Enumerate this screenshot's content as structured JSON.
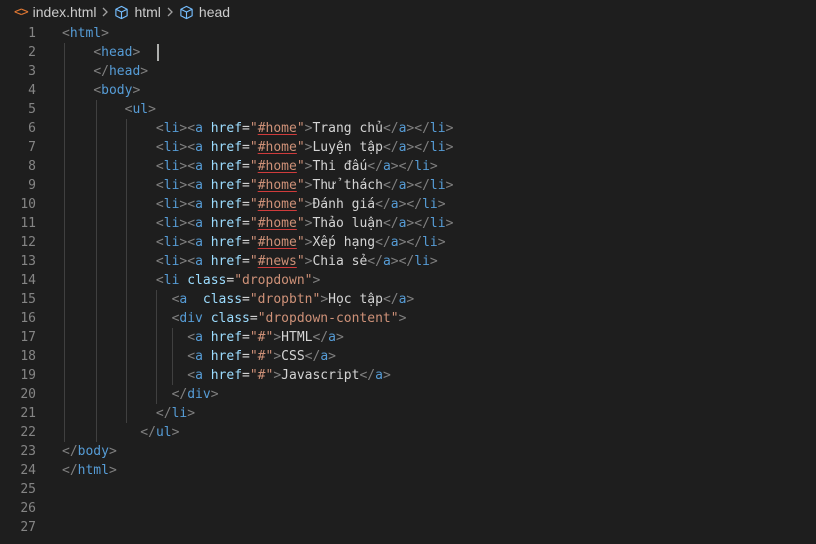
{
  "breadcrumb": {
    "file": "index.html",
    "crumbs": [
      "html",
      "head"
    ]
  },
  "colors": {
    "background": "#1e1e1e",
    "tag": "#569cd6",
    "bracket": "#808080",
    "attribute": "#9cdcfe",
    "string": "#ce9178",
    "text": "#d4d4d4",
    "line_number": "#858585",
    "file_icon": "#e37933"
  },
  "icons": {
    "file": "html-file-icon",
    "symbol": "cube-symbol-icon",
    "separator": "chevron-right-icon"
  },
  "cursor_line": 2,
  "lines": [
    [
      [
        "b",
        "<"
      ],
      [
        "t",
        "html"
      ],
      [
        "b",
        ">"
      ]
    ],
    [
      [
        "b",
        "<"
      ],
      [
        "t",
        "head"
      ],
      [
        "b",
        ">"
      ]
    ],
    [
      [
        "b",
        "</"
      ],
      [
        "t",
        "head"
      ],
      [
        "b",
        ">"
      ]
    ],
    [
      [
        "b",
        "<"
      ],
      [
        "t",
        "body"
      ],
      [
        "b",
        ">"
      ]
    ],
    [
      [
        "b",
        "<"
      ],
      [
        "t",
        "ul"
      ],
      [
        "b",
        ">"
      ]
    ],
    [
      [
        "b",
        "<"
      ],
      [
        "t",
        "li"
      ],
      [
        "b",
        "><"
      ],
      [
        "t",
        "a"
      ],
      [
        "x",
        " "
      ],
      [
        "a",
        "href"
      ],
      [
        "x",
        "="
      ],
      [
        "s",
        "\""
      ],
      [
        "ss",
        "#home"
      ],
      [
        "s",
        "\""
      ],
      [
        "b",
        ">"
      ],
      [
        "x",
        "Trang chủ"
      ],
      [
        "b",
        "</"
      ],
      [
        "t",
        "a"
      ],
      [
        "b",
        "></"
      ],
      [
        "t",
        "li"
      ],
      [
        "b",
        ">"
      ]
    ],
    [
      [
        "b",
        "<"
      ],
      [
        "t",
        "li"
      ],
      [
        "b",
        "><"
      ],
      [
        "t",
        "a"
      ],
      [
        "x",
        " "
      ],
      [
        "a",
        "href"
      ],
      [
        "x",
        "="
      ],
      [
        "s",
        "\""
      ],
      [
        "ss",
        "#home"
      ],
      [
        "s",
        "\""
      ],
      [
        "b",
        ">"
      ],
      [
        "x",
        "Luyện tập"
      ],
      [
        "b",
        "</"
      ],
      [
        "t",
        "a"
      ],
      [
        "b",
        "></"
      ],
      [
        "t",
        "li"
      ],
      [
        "b",
        ">"
      ]
    ],
    [
      [
        "b",
        "<"
      ],
      [
        "t",
        "li"
      ],
      [
        "b",
        "><"
      ],
      [
        "t",
        "a"
      ],
      [
        "x",
        " "
      ],
      [
        "a",
        "href"
      ],
      [
        "x",
        "="
      ],
      [
        "s",
        "\""
      ],
      [
        "ss",
        "#home"
      ],
      [
        "s",
        "\""
      ],
      [
        "b",
        ">"
      ],
      [
        "x",
        "Thi đấu"
      ],
      [
        "b",
        "</"
      ],
      [
        "t",
        "a"
      ],
      [
        "b",
        "></"
      ],
      [
        "t",
        "li"
      ],
      [
        "b",
        ">"
      ]
    ],
    [
      [
        "b",
        "<"
      ],
      [
        "t",
        "li"
      ],
      [
        "b",
        "><"
      ],
      [
        "t",
        "a"
      ],
      [
        "x",
        " "
      ],
      [
        "a",
        "href"
      ],
      [
        "x",
        "="
      ],
      [
        "s",
        "\""
      ],
      [
        "ss",
        "#home"
      ],
      [
        "s",
        "\""
      ],
      [
        "b",
        ">"
      ],
      [
        "x",
        "Thử thách"
      ],
      [
        "b",
        "</"
      ],
      [
        "t",
        "a"
      ],
      [
        "b",
        "></"
      ],
      [
        "t",
        "li"
      ],
      [
        "b",
        ">"
      ]
    ],
    [
      [
        "b",
        "<"
      ],
      [
        "t",
        "li"
      ],
      [
        "b",
        "><"
      ],
      [
        "t",
        "a"
      ],
      [
        "x",
        " "
      ],
      [
        "a",
        "href"
      ],
      [
        "x",
        "="
      ],
      [
        "s",
        "\""
      ],
      [
        "ss",
        "#home"
      ],
      [
        "s",
        "\""
      ],
      [
        "b",
        ">"
      ],
      [
        "x",
        "Đánh giá"
      ],
      [
        "b",
        "</"
      ],
      [
        "t",
        "a"
      ],
      [
        "b",
        "></"
      ],
      [
        "t",
        "li"
      ],
      [
        "b",
        ">"
      ]
    ],
    [
      [
        "b",
        "<"
      ],
      [
        "t",
        "li"
      ],
      [
        "b",
        "><"
      ],
      [
        "t",
        "a"
      ],
      [
        "x",
        " "
      ],
      [
        "a",
        "href"
      ],
      [
        "x",
        "="
      ],
      [
        "s",
        "\""
      ],
      [
        "ss",
        "#home"
      ],
      [
        "s",
        "\""
      ],
      [
        "b",
        ">"
      ],
      [
        "x",
        "Thảo luận"
      ],
      [
        "b",
        "</"
      ],
      [
        "t",
        "a"
      ],
      [
        "b",
        "></"
      ],
      [
        "t",
        "li"
      ],
      [
        "b",
        ">"
      ]
    ],
    [
      [
        "b",
        "<"
      ],
      [
        "t",
        "li"
      ],
      [
        "b",
        "><"
      ],
      [
        "t",
        "a"
      ],
      [
        "x",
        " "
      ],
      [
        "a",
        "href"
      ],
      [
        "x",
        "="
      ],
      [
        "s",
        "\""
      ],
      [
        "ss",
        "#home"
      ],
      [
        "s",
        "\""
      ],
      [
        "b",
        ">"
      ],
      [
        "x",
        "Xếp hạng"
      ],
      [
        "b",
        "</"
      ],
      [
        "t",
        "a"
      ],
      [
        "b",
        "></"
      ],
      [
        "t",
        "li"
      ],
      [
        "b",
        ">"
      ]
    ],
    [
      [
        "b",
        "<"
      ],
      [
        "t",
        "li"
      ],
      [
        "b",
        "><"
      ],
      [
        "t",
        "a"
      ],
      [
        "x",
        " "
      ],
      [
        "a",
        "href"
      ],
      [
        "x",
        "="
      ],
      [
        "s",
        "\""
      ],
      [
        "ss",
        "#news"
      ],
      [
        "s",
        "\""
      ],
      [
        "b",
        ">"
      ],
      [
        "x",
        "Chia sẻ"
      ],
      [
        "b",
        "</"
      ],
      [
        "t",
        "a"
      ],
      [
        "b",
        "></"
      ],
      [
        "t",
        "li"
      ],
      [
        "b",
        ">"
      ]
    ],
    [
      [
        "b",
        "<"
      ],
      [
        "t",
        "li"
      ],
      [
        "x",
        " "
      ],
      [
        "a",
        "class"
      ],
      [
        "x",
        "="
      ],
      [
        "s",
        "\"dropdown\""
      ],
      [
        "b",
        ">"
      ]
    ],
    [
      [
        "b",
        "<"
      ],
      [
        "t",
        "a"
      ],
      [
        "x",
        "  "
      ],
      [
        "a",
        "class"
      ],
      [
        "x",
        "="
      ],
      [
        "s",
        "\"dropbtn\""
      ],
      [
        "b",
        ">"
      ],
      [
        "x",
        "Học tập"
      ],
      [
        "b",
        "</"
      ],
      [
        "t",
        "a"
      ],
      [
        "b",
        ">"
      ]
    ],
    [
      [
        "b",
        "<"
      ],
      [
        "t",
        "div"
      ],
      [
        "x",
        " "
      ],
      [
        "a",
        "class"
      ],
      [
        "x",
        "="
      ],
      [
        "s",
        "\"dropdown-content\""
      ],
      [
        "b",
        ">"
      ]
    ],
    [
      [
        "b",
        "<"
      ],
      [
        "t",
        "a"
      ],
      [
        "x",
        " "
      ],
      [
        "a",
        "href"
      ],
      [
        "x",
        "="
      ],
      [
        "s",
        "\"#\""
      ],
      [
        "b",
        ">"
      ],
      [
        "x",
        "HTML"
      ],
      [
        "b",
        "</"
      ],
      [
        "t",
        "a"
      ],
      [
        "b",
        ">"
      ]
    ],
    [
      [
        "b",
        "<"
      ],
      [
        "t",
        "a"
      ],
      [
        "x",
        " "
      ],
      [
        "a",
        "href"
      ],
      [
        "x",
        "="
      ],
      [
        "s",
        "\"#\""
      ],
      [
        "b",
        ">"
      ],
      [
        "x",
        "CSS"
      ],
      [
        "b",
        "</"
      ],
      [
        "t",
        "a"
      ],
      [
        "b",
        ">"
      ]
    ],
    [
      [
        "b",
        "<"
      ],
      [
        "t",
        "a"
      ],
      [
        "x",
        " "
      ],
      [
        "a",
        "href"
      ],
      [
        "x",
        "="
      ],
      [
        "s",
        "\"#\""
      ],
      [
        "b",
        ">"
      ],
      [
        "x",
        "Javascript"
      ],
      [
        "b",
        "</"
      ],
      [
        "t",
        "a"
      ],
      [
        "b",
        ">"
      ]
    ],
    [
      [
        "b",
        "</"
      ],
      [
        "t",
        "div"
      ],
      [
        "b",
        ">"
      ]
    ],
    [
      [
        "b",
        "</"
      ],
      [
        "t",
        "li"
      ],
      [
        "b",
        ">"
      ]
    ],
    [
      [
        "b",
        "</"
      ],
      [
        "t",
        "ul"
      ],
      [
        "b",
        ">"
      ]
    ],
    [
      [
        "b",
        "</"
      ],
      [
        "t",
        "body"
      ],
      [
        "b",
        ">"
      ]
    ],
    [
      [
        "b",
        "</"
      ],
      [
        "t",
        "html"
      ],
      [
        "b",
        ">"
      ]
    ],
    [],
    [],
    []
  ]
}
